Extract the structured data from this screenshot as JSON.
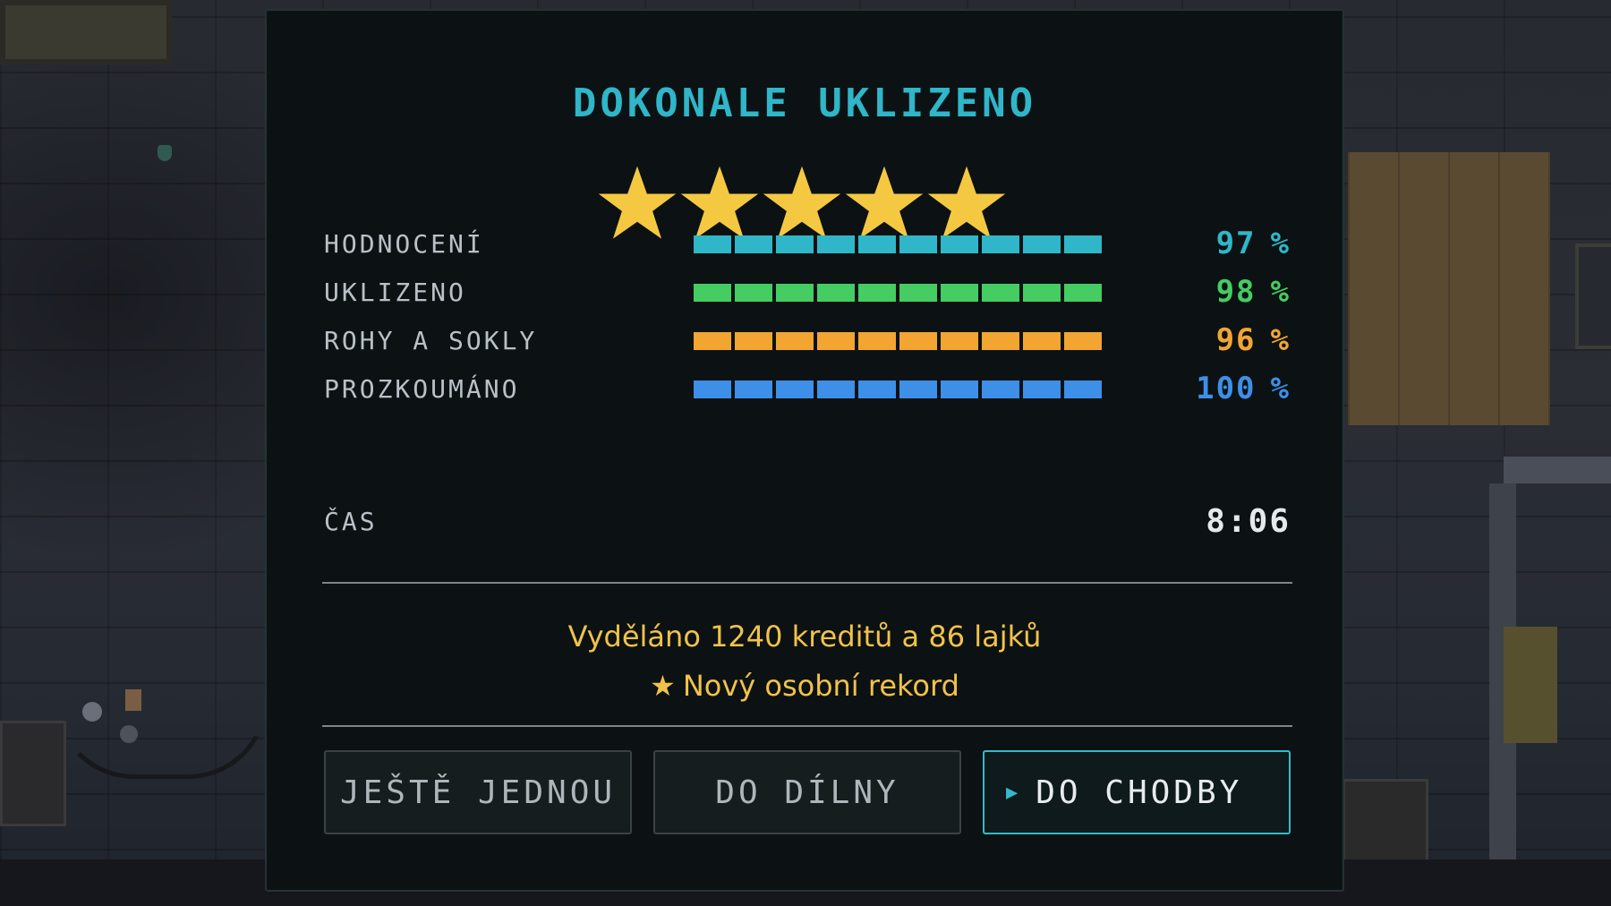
{
  "results": {
    "title": "DOKONALE UKLIZENO",
    "rating_stars": 5,
    "rating_stars_max": 5,
    "star_color": "#f5c842",
    "stats": [
      {
        "label": "HODNOCENÍ",
        "value": "97",
        "unit": "%",
        "fraction": 0.97,
        "color": "#2fb6c9"
      },
      {
        "label": "UKLIZENO",
        "value": "98",
        "unit": "%",
        "fraction": 0.98,
        "color": "#45cc62"
      },
      {
        "label": "ROHY A SOKLY",
        "value": "96",
        "unit": "%",
        "fraction": 0.96,
        "color": "#f2a531"
      },
      {
        "label": "PROZKOUMÁNO",
        "value": "100",
        "unit": "%",
        "fraction": 1.0,
        "color": "#3d8fe8"
      }
    ],
    "time": {
      "label": "ČAS",
      "value": "8:06"
    },
    "earned_text": "Vyděláno 1240 kreditů a 86 lajků",
    "record_icon": "star-icon",
    "record_text": "Nový osobní rekord"
  },
  "buttons": {
    "again_label": "JEŠTĚ JEDNOU",
    "workshop_label": "DO DÍLNY",
    "corridor_label": "DO CHODBY",
    "corridor_icon": "caret-right-icon"
  },
  "colors": {
    "accent": "#35b9c9",
    "gold_text": "#f1c24a",
    "panel_bg": "#0c1213"
  }
}
